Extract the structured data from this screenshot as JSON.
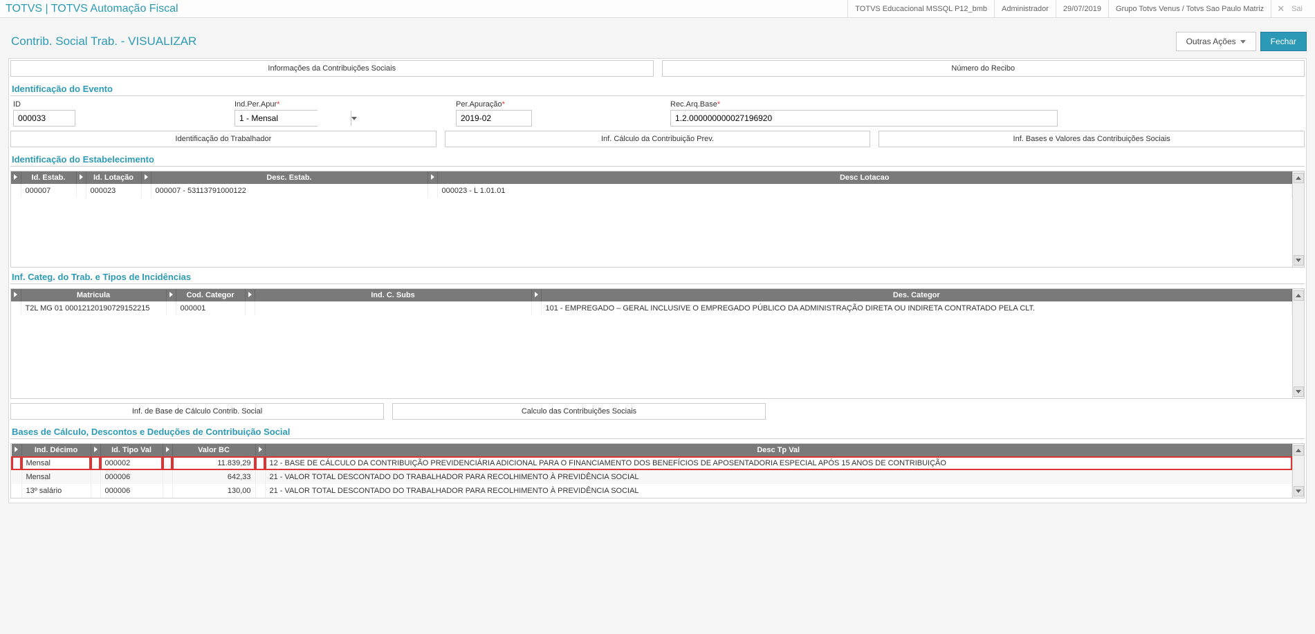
{
  "topbar": {
    "app_title": "TOTVS | TOTVS Automação Fiscal",
    "env": "TOTVS Educacional MSSQL P12_bmb",
    "user": "Administrador",
    "date": "29/07/2019",
    "company": "Grupo Totvs Venus / Totvs Sao Paulo Matriz",
    "close_label": "Sai"
  },
  "page": {
    "title": "Contrib. Social Trab. - VISUALIZAR",
    "btn_outras": "Outras Ações",
    "btn_fechar": "Fechar"
  },
  "tabs_top": {
    "t1": "Informações da Contribuições Sociais",
    "t2": "Número do Recibo"
  },
  "section_ident_evento": "Identificação do Evento",
  "form": {
    "id_label": "ID",
    "id_value": "000033",
    "ind_label": "Ind.Per.Apur",
    "ind_value": "1 - Mensal",
    "per_label": "Per.Apuração",
    "per_value": "2019-02",
    "rec_label": "Rec.Arq.Base",
    "rec_value": "1.2.000000000027196920"
  },
  "tabs_mid": {
    "t1": "Identificação do Trabalhador",
    "t2": "Inf. Cálculo da Contribuição Prev.",
    "t3": "Inf. Bases e Valores das Contribuições Sociais"
  },
  "section_ident_estab": "Identificação do Estabelecimento",
  "grid_estab": {
    "headers": {
      "c1": "Id. Estab.",
      "c2": "Id. Lotação",
      "c3": "Desc. Estab.",
      "c4": "Desc Lotacao"
    },
    "row": {
      "id_estab": "000007",
      "id_lot": "000023",
      "desc_estab": "000007 - 53113791000122",
      "desc_lot": "000023 - L     1.01.01"
    }
  },
  "section_categ": "Inf. Categ. do Trab. e Tipos de Incidências",
  "grid_categ": {
    "headers": {
      "c1": "Matricula",
      "c2": "Cod. Categor",
      "c3": "Ind. C. Subs",
      "c4": "Des. Categor"
    },
    "row": {
      "matricula": "T2L MG 01 00012120190729152215",
      "cod": "000001",
      "ind": "",
      "des": "101 - EMPREGADO – GERAL INCLUSIVE O EMPREGADO PÚBLICO DA ADMINISTRAÇÃO DIRETA OU INDIRETA CONTRATADO PELA CLT."
    }
  },
  "tabs_bottom": {
    "t1": "Inf. de Base de Cálculo Contrib. Social",
    "t2": "Calculo das Contribuições Sociais"
  },
  "section_bases": "Bases de Cálculo, Descontos e Deduções de Contribuição Social",
  "grid_bases": {
    "headers": {
      "c1": "Ind. Décimo",
      "c2": "Id. Tipo Val",
      "c3": "Valor BC",
      "c4": "Desc Tp Val"
    },
    "rows": [
      {
        "ind": "Mensal",
        "id": "000002",
        "valor": "11.839,29",
        "desc": "12 - BASE DE CÁLCULO DA CONTRIBUIÇÃO PREVIDENCIÁRIA ADICIONAL PARA O FINANCIAMENTO DOS BENEFÍCIOS DE APOSENTADORIA ESPECIAL APÓS 15 ANOS DE CONTRIBUIÇÃO"
      },
      {
        "ind": "Mensal",
        "id": "000006",
        "valor": "642,33",
        "desc": "21 - VALOR TOTAL DESCONTADO DO TRABALHADOR PARA RECOLHIMENTO À PREVIDÊNCIA SOCIAL"
      },
      {
        "ind": "13º salário",
        "id": "000006",
        "valor": "130,00",
        "desc": "21 - VALOR TOTAL DESCONTADO DO TRABALHADOR PARA RECOLHIMENTO À PREVIDÊNCIA SOCIAL"
      }
    ]
  }
}
